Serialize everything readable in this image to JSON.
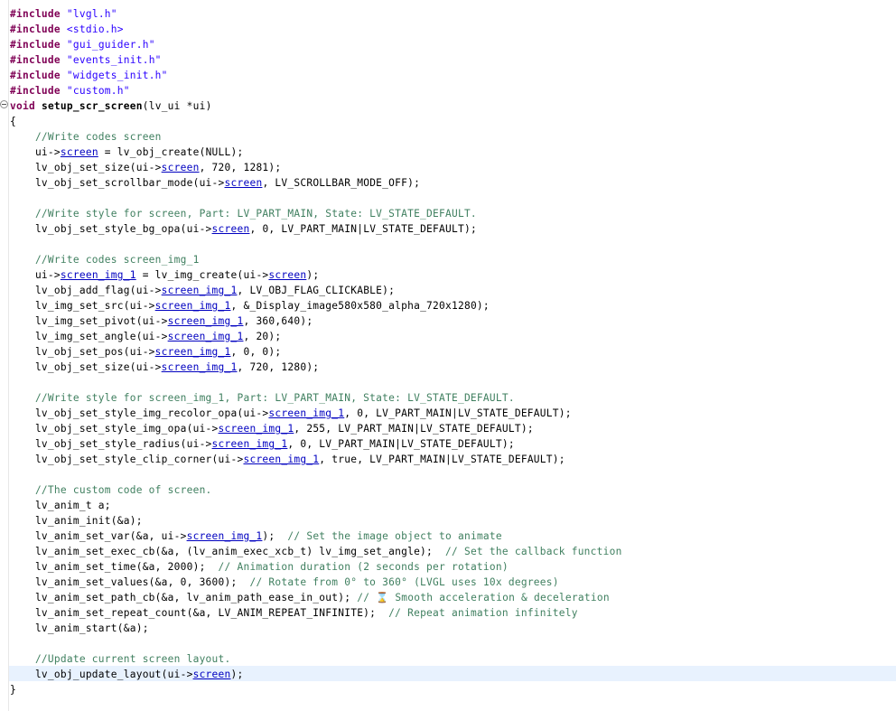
{
  "editor": {
    "colors": {
      "background": "#ffffff",
      "current_line": "#e8f2fe",
      "preprocessor": "#7f0055",
      "string": "#2a00ff",
      "field": "#0000c0",
      "comment": "#3f7f5f",
      "text": "#000000"
    },
    "current_line_index": 43,
    "folded_marker_icon": "collapse-icon",
    "lines": [
      [
        [
          "pp",
          "#include"
        ],
        [
          "pl",
          " "
        ],
        [
          "str",
          "\"lvgl.h\""
        ]
      ],
      [
        [
          "pp",
          "#include"
        ],
        [
          "pl",
          " "
        ],
        [
          "str",
          "<stdio.h>"
        ]
      ],
      [
        [
          "pp",
          "#include"
        ],
        [
          "pl",
          " "
        ],
        [
          "str",
          "\"gui_guider.h\""
        ]
      ],
      [
        [
          "pp",
          "#include"
        ],
        [
          "pl",
          " "
        ],
        [
          "str",
          "\"events_init.h\""
        ]
      ],
      [
        [
          "pp",
          "#include"
        ],
        [
          "pl",
          " "
        ],
        [
          "str",
          "\"widgets_init.h\""
        ]
      ],
      [
        [
          "pp",
          "#include"
        ],
        [
          "pl",
          " "
        ],
        [
          "str",
          "\"custom.h\""
        ]
      ],
      [
        [
          "kw",
          "void"
        ],
        [
          "pl",
          " "
        ],
        [
          "fn",
          "setup_scr_screen"
        ],
        [
          "pl",
          "(lv_ui *ui)"
        ]
      ],
      [
        [
          "pl",
          "{"
        ]
      ],
      [
        [
          "cmt",
          "    //Write codes screen"
        ]
      ],
      [
        [
          "pl",
          "    ui->"
        ],
        [
          "fld",
          "screen"
        ],
        [
          "pl",
          " = lv_obj_create(NULL);"
        ]
      ],
      [
        [
          "pl",
          "    lv_obj_set_size(ui->"
        ],
        [
          "fld",
          "screen"
        ],
        [
          "pl",
          ", 720, 1281);"
        ]
      ],
      [
        [
          "pl",
          "    lv_obj_set_scrollbar_mode(ui->"
        ],
        [
          "fld",
          "screen"
        ],
        [
          "pl",
          ", LV_SCROLLBAR_MODE_OFF);"
        ]
      ],
      [
        [
          "pl",
          ""
        ]
      ],
      [
        [
          "cmt",
          "    //Write style for screen, Part: LV_PART_MAIN, State: LV_STATE_DEFAULT."
        ]
      ],
      [
        [
          "pl",
          "    lv_obj_set_style_bg_opa(ui->"
        ],
        [
          "fld",
          "screen"
        ],
        [
          "pl",
          ", 0, LV_PART_MAIN|LV_STATE_DEFAULT);"
        ]
      ],
      [
        [
          "pl",
          ""
        ]
      ],
      [
        [
          "cmt",
          "    //Write codes screen_img_1"
        ]
      ],
      [
        [
          "pl",
          "    ui->"
        ],
        [
          "fld",
          "screen_img_1"
        ],
        [
          "pl",
          " = lv_img_create(ui->"
        ],
        [
          "fld",
          "screen"
        ],
        [
          "pl",
          ");"
        ]
      ],
      [
        [
          "pl",
          "    lv_obj_add_flag(ui->"
        ],
        [
          "fld",
          "screen_img_1"
        ],
        [
          "pl",
          ", LV_OBJ_FLAG_CLICKABLE);"
        ]
      ],
      [
        [
          "pl",
          "    lv_img_set_src(ui->"
        ],
        [
          "fld",
          "screen_img_1"
        ],
        [
          "pl",
          ", &_Display_image580x580_alpha_720x1280);"
        ]
      ],
      [
        [
          "pl",
          "    lv_img_set_pivot(ui->"
        ],
        [
          "fld",
          "screen_img_1"
        ],
        [
          "pl",
          ", 360,640);"
        ]
      ],
      [
        [
          "pl",
          "    lv_img_set_angle(ui->"
        ],
        [
          "fld",
          "screen_img_1"
        ],
        [
          "pl",
          ", 20);"
        ]
      ],
      [
        [
          "pl",
          "    lv_obj_set_pos(ui->"
        ],
        [
          "fld",
          "screen_img_1"
        ],
        [
          "pl",
          ", 0, 0);"
        ]
      ],
      [
        [
          "pl",
          "    lv_obj_set_size(ui->"
        ],
        [
          "fld",
          "screen_img_1"
        ],
        [
          "pl",
          ", 720, 1280);"
        ]
      ],
      [
        [
          "pl",
          ""
        ]
      ],
      [
        [
          "cmt",
          "    //Write style for screen_img_1, Part: LV_PART_MAIN, State: LV_STATE_DEFAULT."
        ]
      ],
      [
        [
          "pl",
          "    lv_obj_set_style_img_recolor_opa(ui->"
        ],
        [
          "fld",
          "screen_img_1"
        ],
        [
          "pl",
          ", 0, LV_PART_MAIN|LV_STATE_DEFAULT);"
        ]
      ],
      [
        [
          "pl",
          "    lv_obj_set_style_img_opa(ui->"
        ],
        [
          "fld",
          "screen_img_1"
        ],
        [
          "pl",
          ", 255, LV_PART_MAIN|LV_STATE_DEFAULT);"
        ]
      ],
      [
        [
          "pl",
          "    lv_obj_set_style_radius(ui->"
        ],
        [
          "fld",
          "screen_img_1"
        ],
        [
          "pl",
          ", 0, LV_PART_MAIN|LV_STATE_DEFAULT);"
        ]
      ],
      [
        [
          "pl",
          "    lv_obj_set_style_clip_corner(ui->"
        ],
        [
          "fld",
          "screen_img_1"
        ],
        [
          "pl",
          ", true, LV_PART_MAIN|LV_STATE_DEFAULT);"
        ]
      ],
      [
        [
          "pl",
          ""
        ]
      ],
      [
        [
          "cmt",
          "    //The custom code of screen."
        ]
      ],
      [
        [
          "pl",
          "    lv_anim_t a;"
        ]
      ],
      [
        [
          "pl",
          "    lv_anim_init(&a);"
        ]
      ],
      [
        [
          "pl",
          "    lv_anim_set_var(&a, ui->"
        ],
        [
          "fld",
          "screen_img_1"
        ],
        [
          "pl",
          ");  "
        ],
        [
          "cmt",
          "// Set the image object to animate"
        ]
      ],
      [
        [
          "pl",
          "    lv_anim_set_exec_cb(&a, (lv_anim_exec_xcb_t) lv_img_set_angle);  "
        ],
        [
          "cmt",
          "// Set the callback function"
        ]
      ],
      [
        [
          "pl",
          "    lv_anim_set_time(&a, 2000);  "
        ],
        [
          "cmt",
          "// Animation duration (2 seconds per rotation)"
        ]
      ],
      [
        [
          "pl",
          "    lv_anim_set_values(&a, 0, 3600);  "
        ],
        [
          "cmt",
          "// Rotate from 0° to 360° (LVGL uses 10x degrees)"
        ]
      ],
      [
        [
          "pl",
          "    lv_anim_set_path_cb(&a, lv_anim_path_ease_in_out); "
        ],
        [
          "cmt",
          "// ⌛ Smooth acceleration & deceleration"
        ]
      ],
      [
        [
          "pl",
          "    lv_anim_set_repeat_count(&a, LV_ANIM_REPEAT_INFINITE);  "
        ],
        [
          "cmt",
          "// Repeat animation infinitely"
        ]
      ],
      [
        [
          "pl",
          "    lv_anim_start(&a);"
        ]
      ],
      [
        [
          "pl",
          ""
        ]
      ],
      [
        [
          "cmt",
          "    //Update current screen layout."
        ]
      ],
      [
        [
          "pl",
          "    lv_obj_update_layout(ui->"
        ],
        [
          "fld",
          "screen"
        ],
        [
          "pl",
          ");"
        ]
      ],
      [
        [
          "pl",
          "}"
        ]
      ]
    ]
  }
}
